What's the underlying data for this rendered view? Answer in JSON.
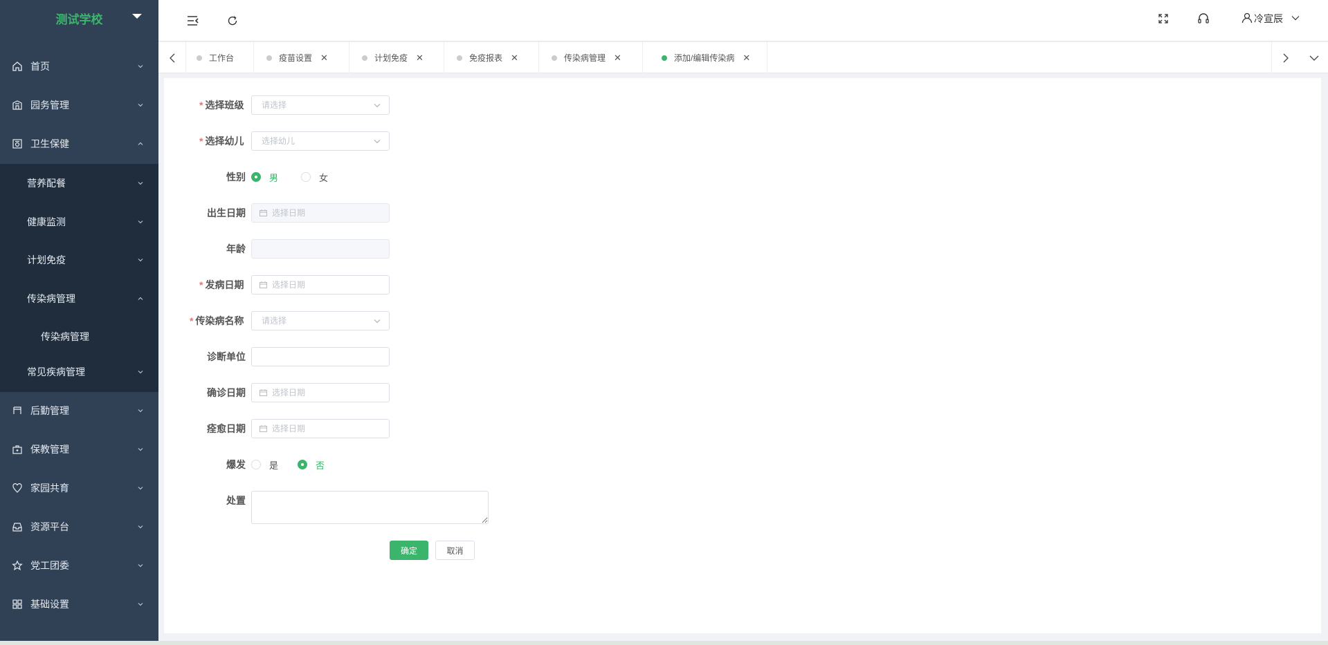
{
  "sidebar": {
    "brand": "测试学校",
    "items": [
      {
        "label": "首页",
        "icon": "home-icon"
      },
      {
        "label": "园务管理",
        "icon": "building-icon"
      },
      {
        "label": "卫生保健",
        "icon": "health-icon"
      },
      {
        "label": "后勤管理",
        "icon": "logistics-icon"
      },
      {
        "label": "保教管理",
        "icon": "education-icon"
      },
      {
        "label": "家园共育",
        "icon": "heart-location-icon"
      },
      {
        "label": "资源平台",
        "icon": "inbox-icon"
      },
      {
        "label": "党工团委",
        "icon": "star-icon"
      },
      {
        "label": "基础设置",
        "icon": "grid-icon"
      }
    ],
    "health_sub": [
      {
        "label": "营养配餐"
      },
      {
        "label": "健康监测"
      },
      {
        "label": "计划免疫"
      },
      {
        "label": "传染病管理"
      },
      {
        "label": "传染病管理"
      },
      {
        "label": "常见疾病管理"
      }
    ]
  },
  "header": {
    "user": "冷宣辰",
    "icons": [
      "menu-fold-icon",
      "refresh-icon",
      "fullscreen-icon",
      "headset-icon",
      "user-icon",
      "chevron-down-icon"
    ]
  },
  "tabs": [
    {
      "label": "工作台",
      "closable": false,
      "active": false
    },
    {
      "label": "疫苗设置",
      "closable": true,
      "active": false
    },
    {
      "label": "计划免疫",
      "closable": true,
      "active": false
    },
    {
      "label": "免疫报表",
      "closable": true,
      "active": false
    },
    {
      "label": "传染病管理",
      "closable": true,
      "active": false
    },
    {
      "label": "添加/编辑传染病",
      "closable": true,
      "active": true
    }
  ],
  "form": {
    "class": {
      "label": "选择班级",
      "placeholder": "请选择"
    },
    "child": {
      "label": "选择幼儿",
      "placeholder": "选择幼儿"
    },
    "gender": {
      "label": "性别",
      "options": [
        "男",
        "女"
      ],
      "selected": "男"
    },
    "birth_date": {
      "label": "出生日期",
      "placeholder": "选择日期"
    },
    "age": {
      "label": "年龄",
      "value": ""
    },
    "onset_date": {
      "label": "发病日期",
      "placeholder": "选择日期"
    },
    "disease": {
      "label": "传染病名称",
      "placeholder": "请选择"
    },
    "diagnosis_unit": {
      "label": "诊断单位",
      "value": ""
    },
    "confirm_date": {
      "label": "确诊日期",
      "placeholder": "选择日期"
    },
    "recovery_date": {
      "label": "痊愈日期",
      "placeholder": "选择日期"
    },
    "outbreak": {
      "label": "爆发",
      "options": [
        "是",
        "否"
      ],
      "selected": "否"
    },
    "disposal": {
      "label": "处置",
      "value": ""
    },
    "submit": "确定",
    "cancel": "取消"
  },
  "colors": {
    "sidebar": "#304156",
    "submenu": "#1f2d3d",
    "accent": "#3bb56c",
    "required": "#f56c6c"
  }
}
